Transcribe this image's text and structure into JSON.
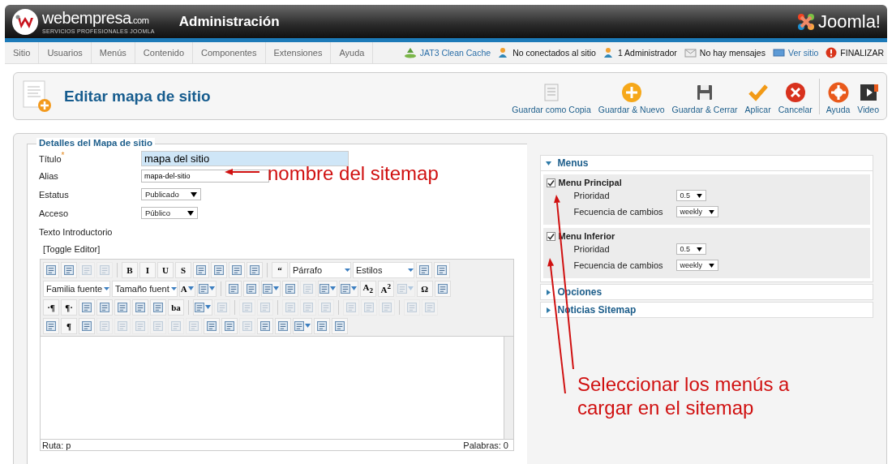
{
  "header": {
    "brand": "webempresa",
    "brand_suffix": ".com",
    "tagline": "SERVICIOS PROFESIONALES JOOMLA",
    "title": "Administración",
    "cms_logo": "Joomla!"
  },
  "menu_bar": [
    "Sitio",
    "Usuarios",
    "Menús",
    "Contenido",
    "Componentes",
    "Extensiones",
    "Ayuda"
  ],
  "status_items": [
    {
      "label": "JAT3 Clean Cache",
      "kind": "cache",
      "link": true
    },
    {
      "label": "No conectados al sitio",
      "kind": "users",
      "link": false
    },
    {
      "label": "1 Administrador",
      "kind": "users",
      "link": false
    },
    {
      "label": "No hay mensajes",
      "kind": "messages",
      "link": false
    },
    {
      "label": "Ver sitio",
      "kind": "site",
      "link": true
    },
    {
      "label": "FINALIZAR",
      "kind": "logout",
      "link": false
    }
  ],
  "toolbar": {
    "title": "Editar mapa de sitio",
    "actions": [
      {
        "label": "Guardar como Copia",
        "kind": "copy"
      },
      {
        "label": "Guardar & Nuevo",
        "kind": "new"
      },
      {
        "label": "Guardar & Cerrar",
        "kind": "save"
      },
      {
        "label": "Aplicar",
        "kind": "apply"
      },
      {
        "label": "Cancelar",
        "kind": "cancel"
      }
    ],
    "help_actions": [
      {
        "label": "Ayuda",
        "kind": "help"
      },
      {
        "label": "Video",
        "kind": "video"
      }
    ]
  },
  "details": {
    "legend": "Detalles del Mapa de sitio",
    "fields": [
      {
        "label": "Título",
        "required_mark": "*",
        "kind": "text",
        "value": "mapa del sitio",
        "highlighted": true
      },
      {
        "label": "Alias",
        "kind": "text",
        "value": "mapa-del-sitio",
        "highlighted": false
      },
      {
        "label": "Estatus",
        "kind": "select",
        "value": "Publicado"
      },
      {
        "label": "Acceso",
        "kind": "select",
        "value": "Público"
      },
      {
        "label": "Texto Introductorio",
        "kind": "heading"
      }
    ],
    "toggle_editor": "[Toggle Editor]",
    "editor": {
      "toolbar_lines": [
        {
          "tools": [
            {
              "kind": "icon",
              "disabled": false
            },
            {
              "kind": "icon",
              "disabled": false
            },
            {
              "kind": "icon",
              "disabled": true
            },
            {
              "kind": "icon",
              "disabled": true
            },
            {
              "kind": "sep"
            },
            {
              "kind": "glyph",
              "label": "B",
              "disabled": false
            },
            {
              "kind": "glyph",
              "label": "I",
              "disabled": false
            },
            {
              "kind": "glyph",
              "label": "U",
              "disabled": false
            },
            {
              "kind": "glyph",
              "label": "S",
              "disabled": false
            },
            {
              "kind": "icon",
              "disabled": false
            },
            {
              "kind": "icon",
              "disabled": false
            },
            {
              "kind": "icon",
              "disabled": false
            },
            {
              "kind": "icon",
              "disabled": false
            },
            {
              "kind": "sep"
            },
            {
              "kind": "glyph",
              "label": "“",
              "disabled": false
            },
            {
              "kind": "select",
              "label": "Párrafo"
            },
            {
              "kind": "select",
              "label": "Estilos"
            },
            {
              "kind": "icon",
              "disabled": false
            },
            {
              "kind": "icon",
              "disabled": false
            }
          ]
        },
        {
          "tools": [
            {
              "kind": "select",
              "label": "Familia fuente"
            },
            {
              "kind": "select",
              "label": "Tamaño fuent"
            },
            {
              "kind": "glyph",
              "label": "A",
              "disabled": false,
              "dropdown": true
            },
            {
              "kind": "icon",
              "disabled": false,
              "dropdown": true
            },
            {
              "kind": "sep"
            },
            {
              "kind": "icon",
              "disabled": false
            },
            {
              "kind": "icon",
              "disabled": false
            },
            {
              "kind": "icon",
              "disabled": false,
              "dropdown": true
            },
            {
              "kind": "icon",
              "disabled": false
            },
            {
              "kind": "icon",
              "disabled": true
            },
            {
              "kind": "icon",
              "disabled": false,
              "dropdown": true
            },
            {
              "kind": "icon",
              "disabled": false,
              "dropdown": true
            },
            {
              "kind": "glyph",
              "label": "A$_{2}$",
              "disabled": false
            },
            {
              "kind": "glyph",
              "label": "A$^{2}$",
              "disabled": false
            },
            {
              "kind": "icon",
              "disabled": true,
              "dropdown": true
            },
            {
              "kind": "glyph",
              "label": "Ω",
              "disabled": false
            },
            {
              "kind": "icon",
              "disabled": false
            }
          ]
        },
        {
          "tools": [
            {
              "kind": "glyph",
              "label": "·¶",
              "disabled": false
            },
            {
              "kind": "glyph",
              "label": "¶·",
              "disabled": false
            },
            {
              "kind": "icon",
              "disabled": false
            },
            {
              "kind": "icon",
              "disabled": false
            },
            {
              "kind": "icon",
              "disabled": false
            },
            {
              "kind": "icon",
              "disabled": false
            },
            {
              "kind": "icon",
              "disabled": false
            },
            {
              "kind": "glyph",
              "label": "ba",
              "disabled": false
            },
            {
              "kind": "sep"
            },
            {
              "kind": "icon",
              "disabled": false,
              "dropdown": true
            },
            {
              "kind": "icon",
              "disabled": true
            },
            {
              "kind": "sep"
            },
            {
              "kind": "icon",
              "disabled": true
            },
            {
              "kind": "icon",
              "disabled": true
            },
            {
              "kind": "sep"
            },
            {
              "kind": "icon",
              "disabled": true
            },
            {
              "kind": "icon",
              "disabled": true
            },
            {
              "kind": "icon",
              "disabled": true
            },
            {
              "kind": "sep"
            },
            {
              "kind": "icon",
              "disabled": true
            },
            {
              "kind": "icon",
              "disabled": true
            },
            {
              "kind": "icon",
              "disabled": true
            },
            {
              "kind": "sep"
            },
            {
              "kind": "icon",
              "disabled": true
            },
            {
              "kind": "icon",
              "disabled": true
            }
          ]
        },
        {
          "tools": [
            {
              "kind": "icon",
              "disabled": false
            },
            {
              "kind": "glyph",
              "label": "¶",
              "disabled": false
            },
            {
              "kind": "icon",
              "disabled": false
            },
            {
              "kind": "icon",
              "disabled": true
            },
            {
              "kind": "icon",
              "disabled": true
            },
            {
              "kind": "icon",
              "disabled": true
            },
            {
              "kind": "icon",
              "disabled": true
            },
            {
              "kind": "icon",
              "disabled": true
            },
            {
              "kind": "icon",
              "disabled": true
            },
            {
              "kind": "icon",
              "disabled": false
            },
            {
              "kind": "icon",
              "disabled": false
            },
            {
              "kind": "icon",
              "disabled": true
            },
            {
              "kind": "icon",
              "disabled": false
            },
            {
              "kind": "icon",
              "disabled": false
            },
            {
              "kind": "icon",
              "disabled": false,
              "dropdown": true
            },
            {
              "kind": "icon",
              "disabled": false
            },
            {
              "kind": "icon",
              "disabled": false
            }
          ]
        }
      ],
      "path": "Ruta: p",
      "word_count": "Palabras: 0"
    }
  },
  "sections": [
    {
      "title": "Menus",
      "expanded": true,
      "items": [
        {
          "label": "Menu Principal",
          "checked": true,
          "priority_label": "Prioridad",
          "priority": "0.5",
          "frequency_label": "Fecuencia de cambios",
          "frequency": "weekly"
        },
        {
          "label": "Menu Inferior",
          "checked": true,
          "priority_label": "Prioridad",
          "priority": "0.5",
          "frequency_label": "Fecuencia de cambios",
          "frequency": "weekly"
        }
      ]
    },
    {
      "title": "Opciones",
      "expanded": false
    },
    {
      "title": "Noticias Sitemap",
      "expanded": false
    }
  ],
  "annotations": [
    "nombre del sitemap",
    "Seleccionar los menús a cargar en el sitemap"
  ]
}
